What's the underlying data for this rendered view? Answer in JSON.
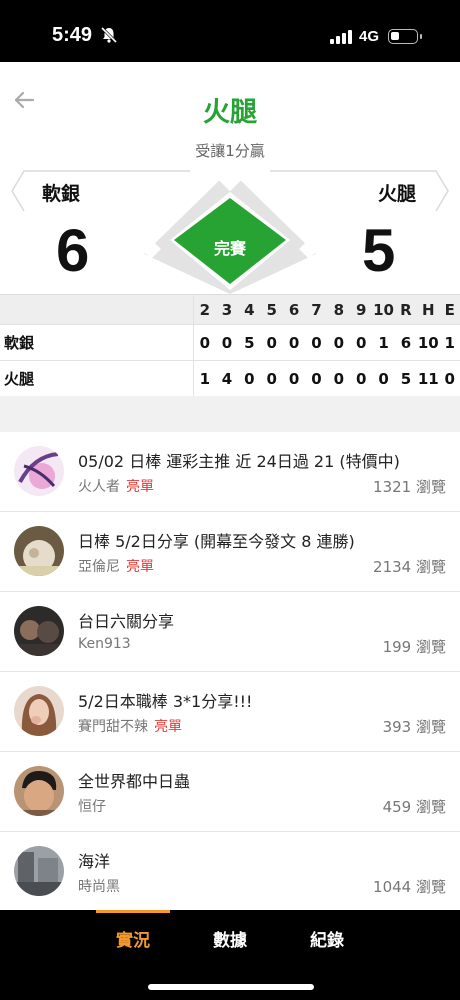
{
  "status_bar": {
    "time": "5:49",
    "network": "4G"
  },
  "header": {
    "title": "火腿",
    "subtitle": "受讓1分贏",
    "away_team": "軟銀",
    "home_team": "火腿",
    "away_score": "6",
    "home_score": "5",
    "game_status": "完賽",
    "accent_color": "#27a334"
  },
  "boxscore": {
    "innings": [
      "2",
      "3",
      "4",
      "5",
      "6",
      "7",
      "8",
      "9",
      "10",
      "R",
      "H",
      "E"
    ],
    "rows": [
      {
        "team": "軟銀",
        "values": [
          "0",
          "0",
          "5",
          "0",
          "0",
          "0",
          "0",
          "0",
          "1",
          "6",
          "10",
          "1"
        ]
      },
      {
        "team": "火腿",
        "values": [
          "1",
          "4",
          "0",
          "0",
          "0",
          "0",
          "0",
          "0",
          "0",
          "5",
          "11",
          "0"
        ]
      }
    ]
  },
  "posts": [
    {
      "title": "05/02 日棒 運彩主推 近 24日過 21 (特價中)",
      "author": "火人者",
      "tag": "亮單",
      "views": "1321 瀏覽"
    },
    {
      "title": "日棒 5/2日分享 (開幕至今發文 8 連勝)",
      "author": "亞倫尼",
      "tag": "亮單",
      "views": "2134 瀏覽"
    },
    {
      "title": "台日六關分享",
      "author": "Ken913",
      "tag": "",
      "views": "199 瀏覽"
    },
    {
      "title": "5/2日本職棒 3*1分享!!!",
      "author": "賽門甜不辣",
      "tag": "亮單",
      "views": "393 瀏覽"
    },
    {
      "title": "全世界都中日蟲",
      "author": "恒仔",
      "tag": "",
      "views": "459 瀏覽"
    },
    {
      "title": "海洋",
      "author": "時尚黑",
      "tag": "",
      "views": "1044 瀏覽"
    }
  ],
  "bottom_nav": {
    "tabs": [
      "實況",
      "數據",
      "紀錄"
    ],
    "active_tab": "實況",
    "active_color": "#f39a2b"
  }
}
